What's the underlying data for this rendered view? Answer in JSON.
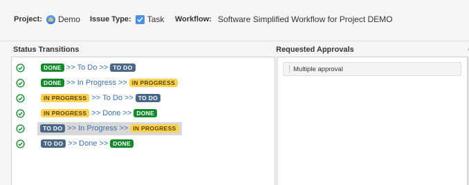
{
  "header": {
    "project_label": "Project:",
    "project_value": "Demo",
    "issue_type_label": "Issue Type:",
    "issue_type_value": "Task",
    "workflow_label": "Workflow:",
    "workflow_value": "Software Simplified Workflow for Project DEMO"
  },
  "status_panel": {
    "title": "Status Transitions",
    "transitions": [
      {
        "from": "DONE",
        "to_text": "To Do",
        "to": "TO DO"
      },
      {
        "from": "DONE",
        "to_text": "In Progress",
        "to": "IN PROGRESS"
      },
      {
        "from": "IN PROGRESS",
        "to_text": "To Do",
        "to": "TO DO"
      },
      {
        "from": "IN PROGRESS",
        "to_text": "Done",
        "to": "DONE"
      },
      {
        "from": "TO DO",
        "to_text": "In Progress",
        "to": "IN PROGRESS",
        "selected": true
      },
      {
        "from": "TO DO",
        "to_text": "Done",
        "to": "DONE"
      }
    ],
    "separator": ">>"
  },
  "approvals_panel": {
    "title": "Requested Approvals",
    "items": [
      "Multiple approval"
    ]
  },
  "colors": {
    "done": "#14892c",
    "todo": "#4a6785",
    "in_progress": "#ffd351",
    "check": "#14892c"
  }
}
